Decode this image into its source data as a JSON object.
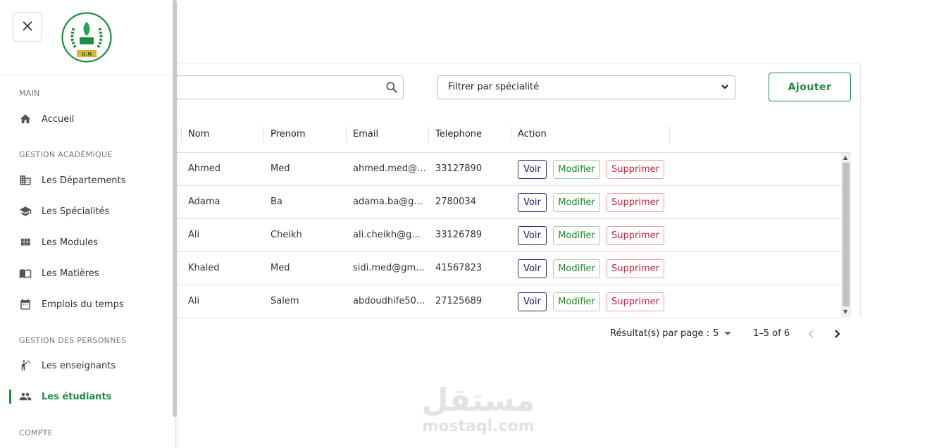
{
  "sidebar": {
    "sections": [
      {
        "title": "MAIN"
      },
      {
        "title": "GESTION ACADÉMIQUE"
      },
      {
        "title": "GESTION DES PERSONNES"
      },
      {
        "title": "COMPTE"
      }
    ],
    "items": [
      {
        "label": "Accueil",
        "icon": "home-icon"
      },
      {
        "label": "Les Départements",
        "icon": "building-icon"
      },
      {
        "label": "Les Spécialités",
        "icon": "graduation-cap-icon"
      },
      {
        "label": "Les Modules",
        "icon": "grid-icon"
      },
      {
        "label": "Les Matières",
        "icon": "book-icon"
      },
      {
        "label": "Emplois du temps",
        "icon": "calendar-icon"
      },
      {
        "label": "Les enseignants",
        "icon": "teacher-icon"
      },
      {
        "label": "Les étudiants",
        "icon": "people-icon",
        "active": true
      }
    ],
    "logo_text": "U.N"
  },
  "toolbar": {
    "filter_label": "Filtrer par spécialité",
    "add_label": "Ajouter"
  },
  "table": {
    "headers": [
      "Nom",
      "Prenom",
      "Email",
      "Telephone",
      "Action"
    ],
    "rows": [
      {
        "nom": "Ahmed",
        "prenom": "Med",
        "email": "ahmed.med@...",
        "tel": "33127890"
      },
      {
        "nom": "Adama",
        "prenom": "Ba",
        "email": "adama.ba@g...",
        "tel": "2780034"
      },
      {
        "nom": "Ali",
        "prenom": "Cheikh",
        "email": "ali.cheikh@g...",
        "tel": "33126789"
      },
      {
        "nom": "Khaled",
        "prenom": "Med",
        "email": "sidi.med@gm...",
        "tel": "41567823"
      },
      {
        "nom": "Ali",
        "prenom": "Salem",
        "email": "abdoudhife50...",
        "tel": "27125689"
      }
    ],
    "actions": {
      "view": "Voir",
      "edit": "Modifier",
      "delete": "Supprimer"
    }
  },
  "pagination": {
    "rows_per_page_label": "Résultat(s) par page :",
    "rows_per_page": "5",
    "range": "1–5 of 6"
  },
  "watermark": {
    "arabic": "مستقل",
    "latin": "mostaql.com"
  },
  "colors": {
    "brand_green": "#1e8c45",
    "view_navy": "#1f1f6b",
    "delete_red": "#c8203b"
  }
}
